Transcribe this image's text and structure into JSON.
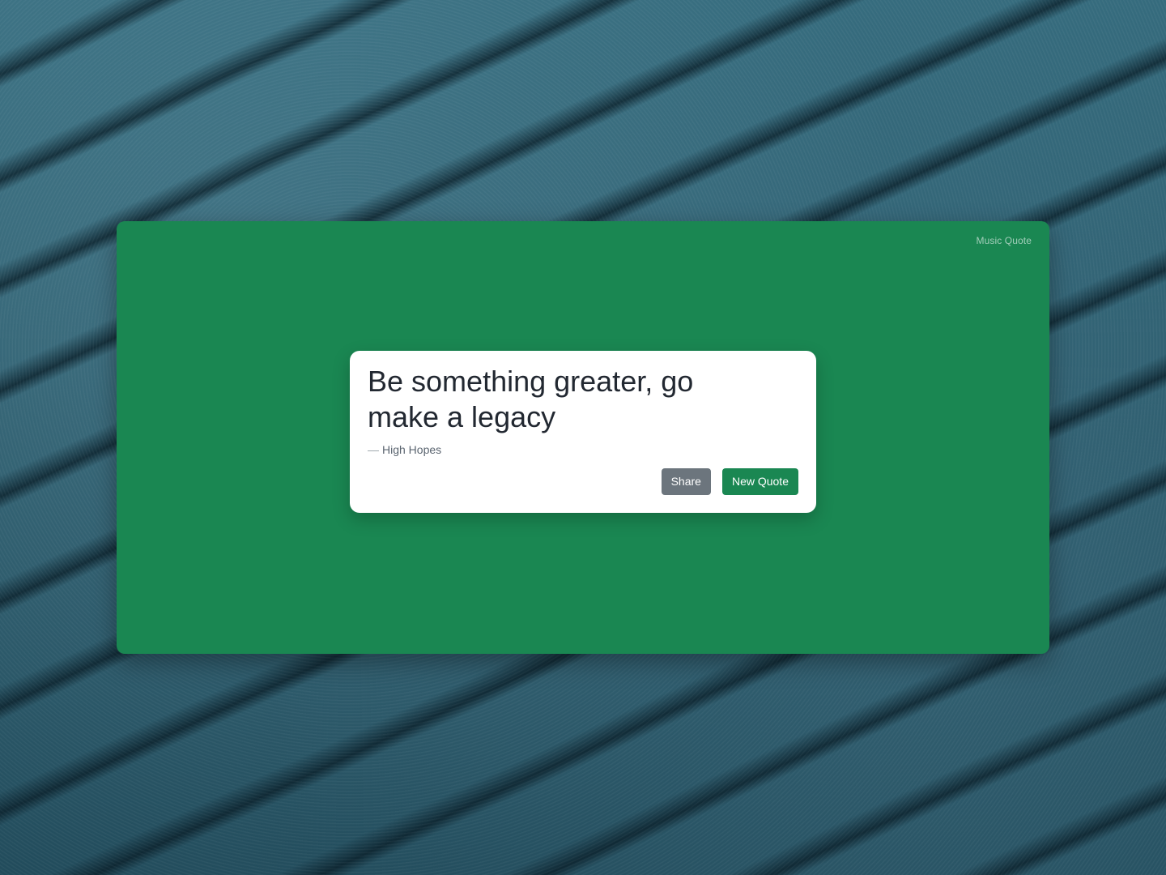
{
  "app": {
    "label": "Music Quote"
  },
  "quote": {
    "text": "Be something greater, go make a legacy",
    "dash": "—",
    "source": "High Hopes"
  },
  "actions": {
    "share_label": "Share",
    "new_quote_label": "New Quote"
  },
  "colors": {
    "app_background": "#1a8752",
    "card_background": "#ffffff",
    "share_button": "#6c757d",
    "new_quote_button": "#1a8752",
    "quote_text": "#222831"
  }
}
